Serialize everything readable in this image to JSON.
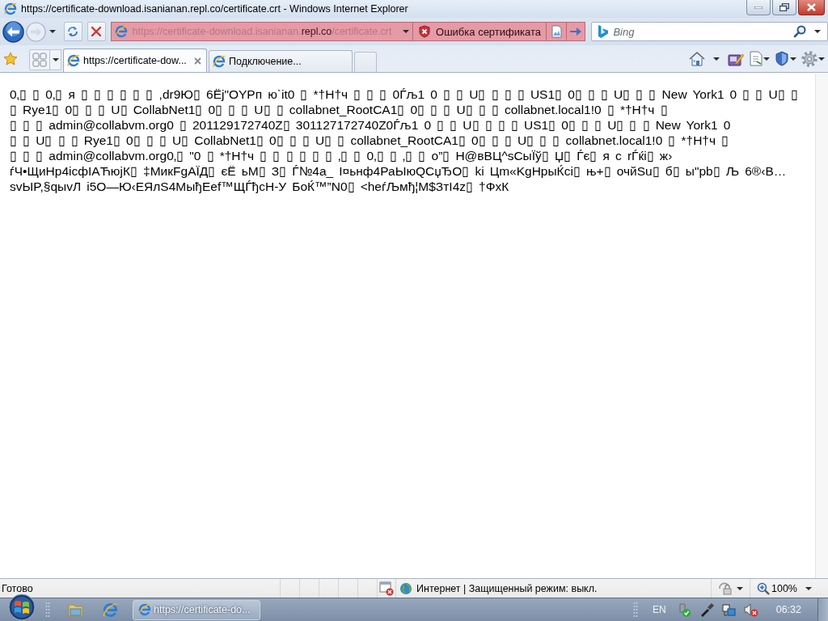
{
  "window": {
    "title": "https://certificate-download.isanianan.repl.co/certificate.crt - Windows Internet Explorer"
  },
  "address_bar": {
    "url": "https://certificate-download.isanianan.**repl.co**/certificate.crt",
    "certificate_error": "Ошибка сертификата"
  },
  "search": {
    "placeholder": "Bing"
  },
  "tabs": [
    {
      "label": "https://certificate-dow...",
      "selected": true
    },
    {
      "label": "Подключение...",
      "selected": false
    }
  ],
  "page": {
    "lines": [
      "0‚▯ ▯ 0‚▯ я ▯ ▯ ▯ ▯ ▯ ▯ ,dr9Ю▯ 6Ёj\"ОYРп ю`it0 ▯ *†H†ч ▯ ▯ ▯ 0Ѓљ1 0 ▯ ▯ U▯ ▯ ▯ ▯ US1▯ 0▯ ▯ ▯ U▯ ▯ ▯ New York1 0 ▯ ▯ U▯ ▯",
      "▯ Rye1▯ 0▯ ▯ ▯ U▯ CollabNet1▯ 0▯ ▯ ▯ U▯ ▯ collabnet_RootCA1▯ 0▯ ▯ ▯ U▯ ▯ ▯ collabnet.local1!0 ▯ *†H†ч ▯",
      "▯ ▯ ▯ admin@collabvm.org0 ▯ 201129172740Z▯ 301127172740Z0Ѓљ1 0 ▯ ▯ U▯ ▯ ▯ ▯ US1▯ 0▯ ▯ ▯ U▯ ▯ ▯ New York1 0",
      "▯ ▯ U▯ ▯ ▯ Rye1▯ 0▯ ▯ ▯ U▯ CollabNet1▯ 0▯ ▯ ▯ U▯ ▯ collabnet_RootCA1▯ 0▯ ▯ ▯ U▯ ▯ ▯ collabnet.local1!0 ▯ *†H†ч ▯",
      "▯ ▯ ▯ admin@collabvm.org0‚▯ \"0 ▯ *†H†ч ▯ ▯ ▯ ▯ ▯ ▯ ‚▯ ▯ 0‚▯ ▯ ‚▯ ▯ o”▯ H@вВЦ^sСыЇў▯ Џ▯ Ѓє▯ я с rЃќі▯ ж›",
      "ѓЧ•ЩиНр4icфIAЋюјК▯ ‡МикFgAЇД▯ єЁ ьМ▯ З▯ Ѓ№4a_ I¤ьнф4РаЫюQCџЂO▯ ki Цm«KgНрыЌсі▯ њ+▯ очйSu▯ б▯ ы\"pb▯ Љ 6®‹B…",
      "svЫP,§qыvЛ i5O—Ю‹ЕЯлS4МыђЕef™ЩЃђсН-У БоЌ™”N0▯ <heѓЉмђ¦M$ЗтI4z▯ †ФxК"
    ]
  },
  "status_bar": {
    "status": "Готово",
    "zone": "Интернет | Защищенный режим: выкл.",
    "zoom": "100%"
  },
  "taskbar": {
    "windows": [
      {
        "label": "https://certificate-do...",
        "selected": true
      }
    ],
    "language": "EN",
    "clock": "06:32"
  }
}
